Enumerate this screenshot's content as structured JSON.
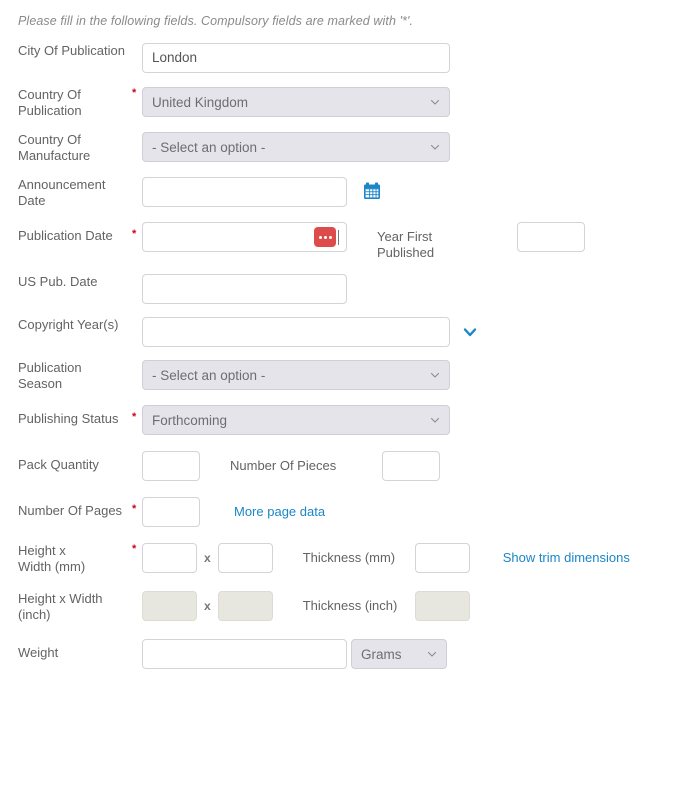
{
  "instruction": "Please fill in the following fields. Compulsory fields are marked with '*'.",
  "required_marker": "*",
  "x_separator": "x",
  "colors": {
    "required_asterisk": "#d0021b",
    "link": "#1b86c8",
    "calendar_icon": "#1b86c8",
    "date_badge": "#dd4b4b",
    "select_background": "#e4e4ea",
    "disabled_background": "#e7e7e0",
    "label_text": "#636363"
  },
  "fields": {
    "city_of_publication": {
      "label": "City Of Publication",
      "value": "London",
      "required": false
    },
    "country_of_publication": {
      "label": "Country Of Publication",
      "label_line1": "Country Of",
      "label_line2": "Publication",
      "value": "United Kingdom",
      "required": true
    },
    "country_of_manufacture": {
      "label": "Country Of Manufacture",
      "label_line1": "Country Of",
      "label_line2": "Manufacture",
      "value": "- Select an option -",
      "required": false
    },
    "announcement_date": {
      "label": "Announcement Date",
      "label_line1": "Announcement",
      "label_line2": "Date",
      "value": "",
      "required": false,
      "icon": "calendar-icon"
    },
    "publication_date": {
      "label": "Publication Date",
      "value": "",
      "required": true,
      "badge": "date-picker-badge"
    },
    "year_first_published": {
      "label": "Year First Published",
      "label_line1": "Year First",
      "label_line2": "Published",
      "value": "",
      "required": false
    },
    "us_pub_date": {
      "label": "US Pub. Date",
      "value": "",
      "required": false
    },
    "copyright_years": {
      "label": "Copyright Year(s)",
      "value": "",
      "required": false,
      "icon": "chevron-down-icon"
    },
    "publication_season": {
      "label": "Publication Season",
      "label_line1": "Publication",
      "label_line2": "Season",
      "value": "- Select an option -",
      "required": false
    },
    "publishing_status": {
      "label": "Publishing Status",
      "value": "Forthcoming",
      "required": true
    },
    "pack_quantity": {
      "label": "Pack Quantity",
      "value": "",
      "required": false
    },
    "number_of_pieces": {
      "label": "Number Of Pieces",
      "value": "",
      "required": false
    },
    "number_of_pages": {
      "label": "Number Of Pages",
      "value": "",
      "required": true
    },
    "more_page_data_link": {
      "label": "More page data"
    },
    "height_width_mm": {
      "label": "Height x Width (mm)",
      "label_line1": "Height x",
      "label_line2": "Width (mm)",
      "height_value": "",
      "width_value": "",
      "required": true
    },
    "thickness_mm": {
      "label": "Thickness (mm)",
      "value": "",
      "required": false
    },
    "show_trim_dimensions_link": {
      "label": "Show trim dimensions"
    },
    "height_width_inch": {
      "label": "Height x Width (inch)",
      "label_line1": "Height x Width",
      "label_line2": "(inch)",
      "height_value": "",
      "width_value": "",
      "required": false,
      "disabled": true
    },
    "thickness_inch": {
      "label": "Thickness (inch)",
      "value": "",
      "required": false,
      "disabled": true
    },
    "weight": {
      "label": "Weight",
      "value": "",
      "unit_value": "Grams",
      "required": false
    }
  }
}
